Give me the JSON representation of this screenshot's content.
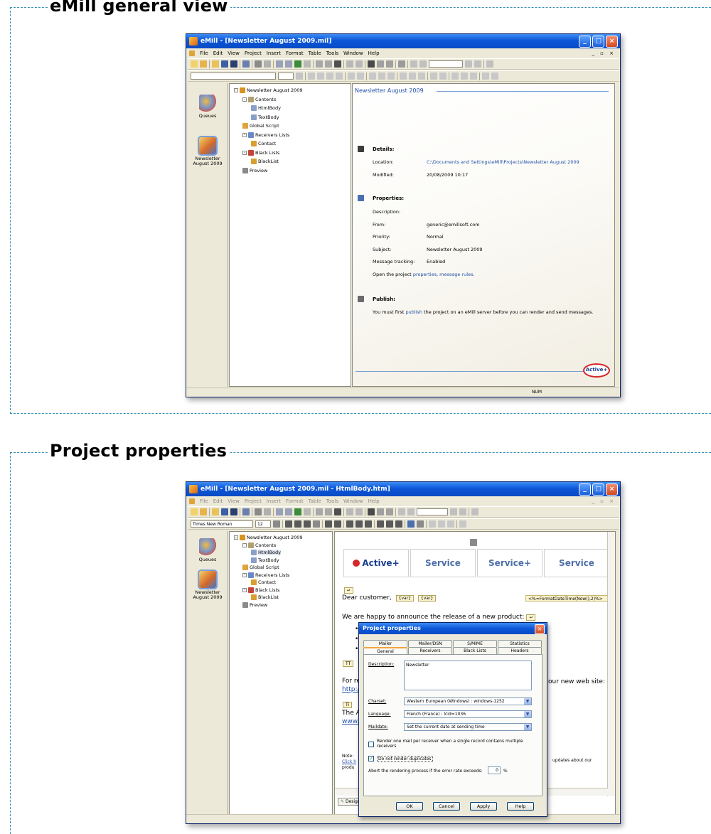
{
  "section1": {
    "legend": "eMill general view",
    "window": {
      "title": "eMill - [Newsletter August 2009.mil]",
      "menu": [
        "File",
        "Edit",
        "View",
        "Project",
        "Insert",
        "Format",
        "Table",
        "Tools",
        "Window",
        "Help"
      ],
      "leftbar": [
        {
          "label": "Queues",
          "icon": "queues-icon"
        },
        {
          "label": "Newsletter August 2009",
          "icon": "newsletter-icon",
          "selected": true
        }
      ],
      "tree": [
        {
          "label": "Newsletter August 2009",
          "level": 0,
          "expander": "-"
        },
        {
          "label": "Contents",
          "level": 1,
          "expander": "-"
        },
        {
          "label": "HtmlBody",
          "level": 2
        },
        {
          "label": "TextBody",
          "level": 2
        },
        {
          "label": "Global Script",
          "level": 1
        },
        {
          "label": "Receivers Lists",
          "level": 1,
          "expander": "-"
        },
        {
          "label": "Contact",
          "level": 2
        },
        {
          "label": "Black Lists",
          "level": 1,
          "expander": "-"
        },
        {
          "label": "BlackList",
          "level": 2
        },
        {
          "label": "Preview",
          "level": 1
        }
      ],
      "content": {
        "title": "Newsletter August 2009",
        "details": {
          "heading": "Details:",
          "location_label": "Location:",
          "location_value": "C:\\Documents and Settings\\eMill\\Projects\\Newsletter August 2009",
          "modified_label": "Modified:",
          "modified_value": "20/08/2009 10:17"
        },
        "properties": {
          "heading": "Properties:",
          "description_label": "Description:",
          "description_value": "",
          "from_label": "From:",
          "from_value": "generic@emillsoft.com",
          "priority_label": "Priority:",
          "priority_value": "Normal",
          "subject_label": "Subject:",
          "subject_value": "Newsletter August 2009",
          "tracking_label": "Message tracking:",
          "tracking_value": "Enabled",
          "open_prefix": "Open the project",
          "open_link1": "properties",
          "open_sep": ",",
          "open_link2": "message rules",
          "open_suffix": "."
        },
        "publish": {
          "heading": "Publish:",
          "text_prefix": "You must first",
          "text_link": "publish",
          "text_suffix": "the project on an eMill server before you can render and send messages."
        },
        "logo": "Active+"
      },
      "status": "NUM"
    }
  },
  "section2": {
    "legend": "Project properties",
    "window": {
      "title": "eMill - [Newsletter August 2009.mil - HtmlBody.htm]",
      "menu": [
        "File",
        "Edit",
        "View",
        "Project",
        "Insert",
        "Format",
        "Table",
        "Tools",
        "Window",
        "Help"
      ],
      "font_name": "Times New Roman",
      "font_size": "12",
      "leftbar": [
        {
          "label": "Queues",
          "icon": "queues-icon"
        },
        {
          "label": "Newsletter August 2009",
          "icon": "newsletter-icon",
          "selected": true
        }
      ],
      "tree": [
        {
          "label": "Newsletter August 2009",
          "level": 0,
          "expander": "-"
        },
        {
          "label": "Contents",
          "level": 1,
          "expander": "-"
        },
        {
          "label": "HtmlBody",
          "level": 2,
          "selected": true
        },
        {
          "label": "TextBody",
          "level": 2
        },
        {
          "label": "Global Script",
          "level": 1
        },
        {
          "label": "Receivers Lists",
          "level": 1,
          "expander": "-"
        },
        {
          "label": "Contact",
          "level": 2
        },
        {
          "label": "Black Lists",
          "level": 1,
          "expander": "-"
        },
        {
          "label": "BlackList",
          "level": 2
        },
        {
          "label": "Preview",
          "level": 1
        }
      ],
      "editor": {
        "logos": [
          "Active+",
          "Service",
          "Service+",
          "Service"
        ],
        "dear": "Dear customer,",
        "chip1": "{var}",
        "chip2": "{var}",
        "field_code": "<%=FormatDateTime(Now(),2)%>",
        "announce": "We are happy to announce the release of a new product:",
        "for_prefix": "For re",
        "our_site": "our new web site:",
        "http_prefix": "http:/",
        "the_a": "The A",
        "www_prefix": "www.",
        "note_prefix": "Note:",
        "click_prefix": "Click h",
        "produ_prefix": "produ",
        "updates": "updates about our",
        "design_tab": "Design"
      },
      "dialog": {
        "title": "Project properties",
        "tabs_back": [
          "Mailer",
          "Mailer/DSN",
          "S/MIME",
          "Statistics"
        ],
        "tabs_front": [
          "General",
          "Receivers",
          "Black Lists",
          "Headers"
        ],
        "active_tab": "General",
        "description_label": "Description:",
        "description_value": "Newsletter",
        "charset_label": "Charset:",
        "charset_value": "Western European (Windows) : windows-1252",
        "language_label": "Language:",
        "language_value": "French (France) : lcid=1036",
        "maildate_label": "Maildate:",
        "maildate_value": "Set the current date at sending time",
        "check1_label": "Render one mail per receiver when a single record contains multiple receivers",
        "check1_checked": false,
        "check2_label": "Do not render duplicates",
        "check2_checked": true,
        "abort_label": "Abort the rendering process if the error rate exceeds:",
        "abort_value": "0",
        "abort_unit": "%",
        "buttons": [
          "OK",
          "Cancel",
          "Apply",
          "Help"
        ]
      }
    }
  },
  "colors": {
    "frame_dash": "#3a8fb5",
    "xp_title": "#0b56d8",
    "link": "#1f4fa8",
    "window_bg": "#ece9d8"
  }
}
